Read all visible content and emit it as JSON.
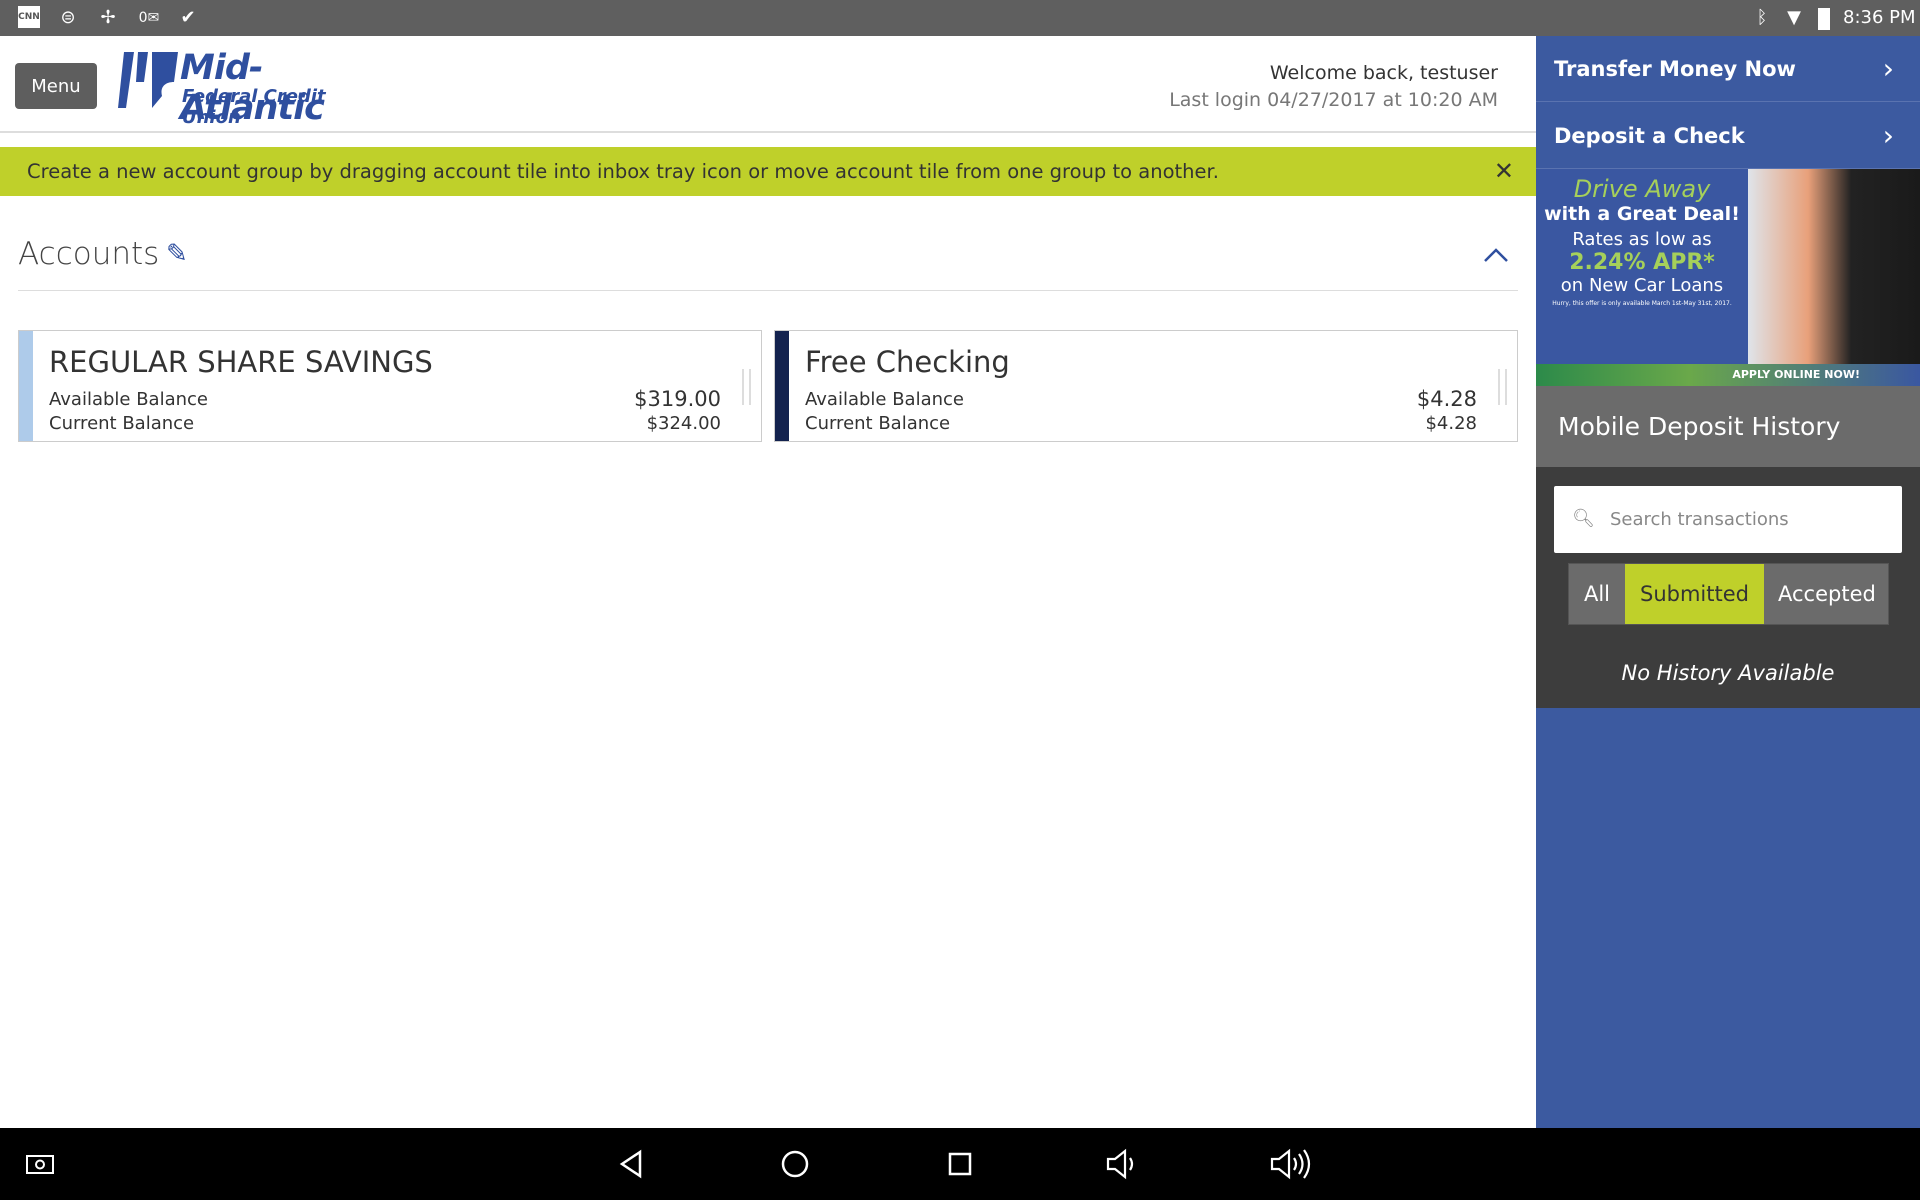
{
  "status_bar": {
    "icons": [
      "cnn-icon",
      "sync-icon",
      "pinwheel-icon",
      "outlook-icon",
      "briefcase-check-icon"
    ],
    "right_icons": [
      "bluetooth-icon",
      "wifi-icon",
      "battery-icon"
    ],
    "time": "8:36 PM",
    "cnn_label": "CNN"
  },
  "header": {
    "menu_label": "Menu",
    "logo_line1": "Mid-Atlantic",
    "logo_line2": "Federal Credit Union",
    "welcome": "Welcome back, testuser",
    "last_login": "Last login 04/27/2017 at 10:20 AM"
  },
  "banner": {
    "text": "Create a new account group by dragging account tile into inbox tray icon or move account tile from one group to another.",
    "close_icon": "close-icon"
  },
  "accounts": {
    "title": "Accounts",
    "tiles": [
      {
        "name": "REGULAR SHARE SAVINGS",
        "available_label": "Available Balance",
        "available": "$319.00",
        "current_label": "Current Balance",
        "current": "$324.00",
        "color": "#aecbea"
      },
      {
        "name": "Free Checking",
        "available_label": "Available Balance",
        "available": "$4.28",
        "current_label": "Current Balance",
        "current": "$4.28",
        "color": "#13224e"
      }
    ]
  },
  "sidebar": {
    "transfer": "Transfer Money Now",
    "deposit": "Deposit a Check",
    "ad": {
      "line1": "Drive Away",
      "line2": "with a Great Deal!",
      "line3": "Rates as low as",
      "line4": "2.24% APR*",
      "line5": "on New Car Loans",
      "fine": "Hurry, this offer is only available March 1st-May 31st, 2017.",
      "cta": "APPLY ONLINE NOW!"
    },
    "history_title": "Mobile Deposit History",
    "search_placeholder": "Search transactions",
    "filters": [
      "All",
      "Submitted",
      "Accepted"
    ],
    "active_filter": "Submitted",
    "empty": "No History Available"
  },
  "colors": {
    "accent": "#bfd02a",
    "brand": "#3c5aa0"
  }
}
